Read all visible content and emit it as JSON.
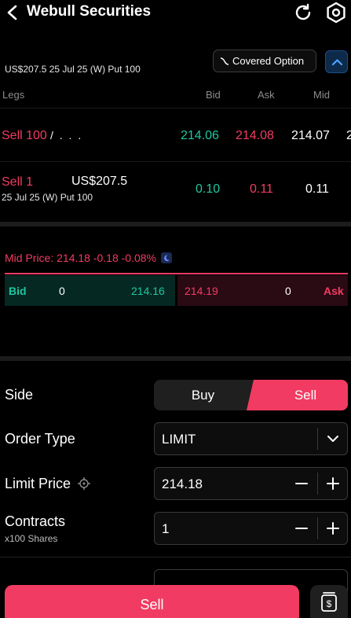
{
  "header": {
    "title": "Webull Securities"
  },
  "order": {
    "symbol_line": "US$207.5 25 Jul 25 (W) Put 100",
    "covered_option_label": "Covered Option"
  },
  "legs_table": {
    "columns": [
      "Legs",
      "Bid",
      "Ask",
      "Mid"
    ],
    "rows": [
      {
        "action": "Sell 100",
        "name_fragment": "/  .  .  .",
        "bid": "214.06",
        "ask": "214.08",
        "mid": "214.07",
        "overflow": "2"
      },
      {
        "action": "Sell 1",
        "strike": "US$207.5",
        "desc": "25 Jul 25 (W) Put 100",
        "bid": "0.10",
        "ask": "0.11",
        "mid": "0.11"
      }
    ]
  },
  "quote": {
    "mid_price": "Mid Price: 214.18 -0.18 -0.08%",
    "bid_label": "Bid",
    "bid_size": "0",
    "bid_price": "214.16",
    "ask_price": "214.19",
    "ask_size": "0",
    "ask_label": "Ask"
  },
  "form": {
    "side_label": "Side",
    "side_options": [
      "Buy",
      "Sell"
    ],
    "side_selected": "Sell",
    "order_type_label": "Order Type",
    "order_type_value": "LIMIT",
    "limit_price_label": "Limit Price",
    "limit_price_value": "214.18",
    "contracts_label": "Contracts",
    "contracts_sub": "x100 Shares",
    "contracts_value": "1"
  },
  "actions": {
    "sell_label": "Sell"
  },
  "colors": {
    "red": "#f23b62",
    "green": "#1fc6a1",
    "accent_blue": "#1a4f86"
  }
}
